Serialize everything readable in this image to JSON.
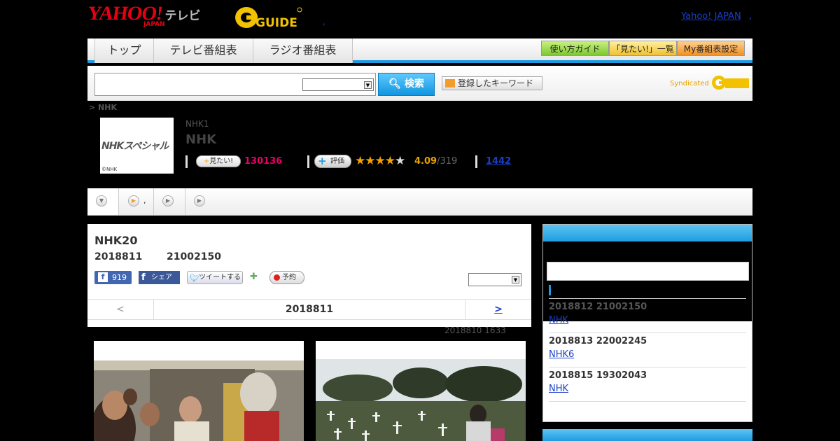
{
  "header": {
    "logo_yahoo": "YAHOO!",
    "logo_japan": "JAPAN",
    "logo_tv": "テレビ",
    "logo_gguide": "GUIDE",
    "dot": ",",
    "yahoo_japan_link": "Yahoo! JAPAN",
    "yahoo_japan_dot": ","
  },
  "nav": {
    "tabs": [
      "トップ",
      "テレビ番組表",
      "ラジオ番組表"
    ],
    "buttons": [
      "使い方ガイド",
      "「見たい!」一覧",
      "My番組表設定"
    ]
  },
  "search": {
    "button_label": "検索",
    "keyword_button": "登録したキーワード",
    "syndicated": "Syndicated"
  },
  "breadcrumb": "> NHK",
  "program": {
    "image_text": "NHKスペシャル",
    "image_copyright": "©NHK",
    "channel": "NHK1",
    "title": "NHK",
    "mitai_label": "見たい!",
    "mitai_count": "130136",
    "hyoka_label": "評価",
    "stars_filled": "★★★★",
    "stars_empty": "★",
    "rating": "4.09",
    "rating_count": "/319",
    "review_count": "1442"
  },
  "tabs_bar": {
    "tab2_label": ","
  },
  "episode": {
    "title": "NHK20",
    "date": "2018811",
    "time": "21002150",
    "fb_like_count": "919",
    "fb_share": "シェア",
    "tweet": "ツイートする",
    "yoyaku": "予約",
    "prev": "<",
    "current_date": "2018811",
    "next": ">",
    "updated": "2018810  1633"
  },
  "right_panel": {
    "items": [
      {
        "datetime": "2018812  21002150",
        "link": "NHK"
      },
      {
        "datetime": "2018813  22002245",
        "link": "NHK6"
      },
      {
        "datetime": "2018815  19302043",
        "link": "NHK"
      }
    ]
  }
}
